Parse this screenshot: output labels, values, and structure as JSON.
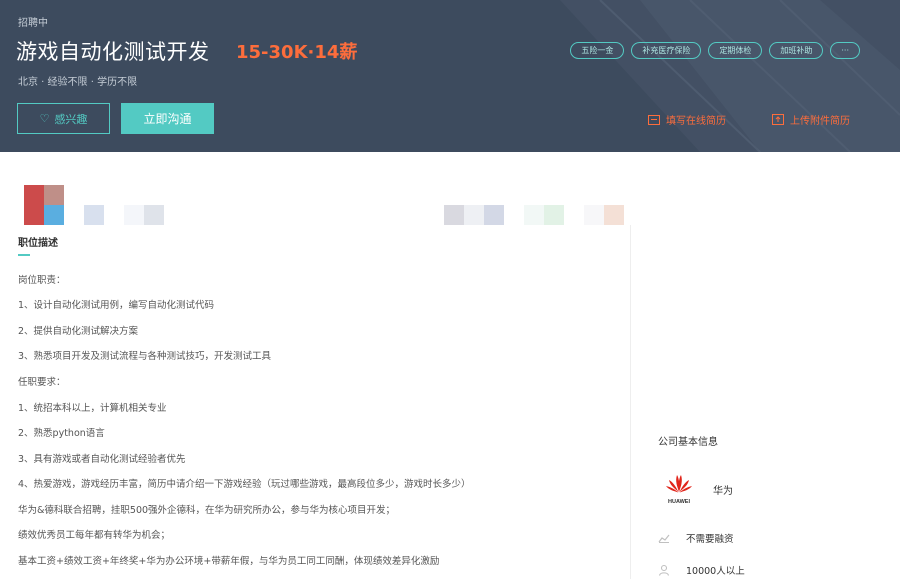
{
  "header": {
    "status": "招聘中",
    "title": "游戏自动化测试开发",
    "salary": "15-30K·14薪",
    "meta": "北京 · 经验不限 · 学历不限",
    "tags": [
      "五险一金",
      "补充医疗保险",
      "定期体检",
      "加班补助",
      "···"
    ],
    "interest_button": "感兴趣",
    "chat_button": "立即沟通",
    "resume_online": "填写在线简历",
    "resume_upload": "上传附件简历"
  },
  "main": {
    "section_title": "职位描述",
    "lines": [
      "岗位职责：",
      "1、设计自动化测试用例，编写自动化测试代码",
      "2、提供自动化测试解决方案",
      "3、熟悉项目开发及测试流程与各种测试技巧，开发测试工具",
      "任职要求：",
      "1、统招本科以上，计算机相关专业",
      "2、熟悉python语言",
      "3、具有游戏或者自动化测试经验者优先",
      "4、热爱游戏，游戏经历丰富，简历中请介绍一下游戏经验（玩过哪些游戏，最高段位多少，游戏时长多少）",
      "华为&德科联合招聘，挂职500强外企德科，在华为研究所办公，参与华为核心项目开发；",
      "绩效优秀员工每年都有转华为机会；",
      "基本工资+绩效工资+年终奖+华为办公环境+带薪年假，与华为员工同工同酬，体现绩效差异化激励"
    ]
  },
  "sidebar": {
    "heading": "公司基本信息",
    "company_name": "华为",
    "logo_text": "HUAWEI",
    "financing": "不需要融资",
    "size": "10000人以上"
  },
  "colors": {
    "accent": "#53cac3",
    "salary": "#fd6d3c",
    "banner": "#3d4b5e",
    "huawei_red": "#e1251b"
  },
  "icons": [
    "heart-icon",
    "form-icon",
    "upload-icon",
    "financing-icon",
    "people-icon"
  ]
}
